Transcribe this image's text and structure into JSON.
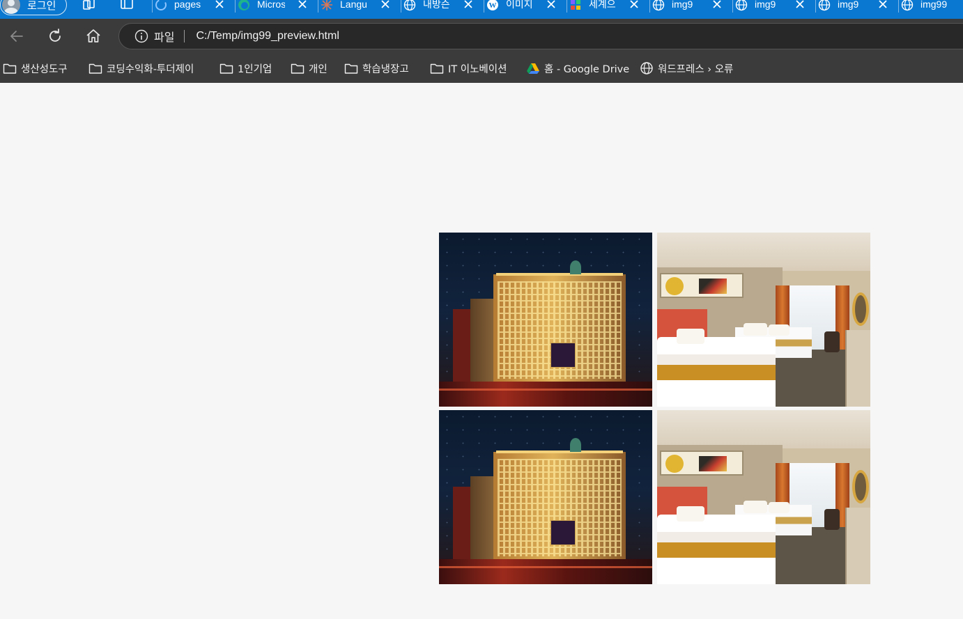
{
  "browser": {
    "profile": {
      "label": "로그인",
      "icon": "person-avatar-icon"
    },
    "tabs": [
      {
        "title": "pages",
        "favicon": "github-icon"
      },
      {
        "title": "Micros",
        "favicon": "edge-icon"
      },
      {
        "title": "Langu",
        "favicon": "claude-star-icon"
      },
      {
        "title": "내방슨",
        "favicon": "globe-icon"
      },
      {
        "title": "이미지",
        "favicon": "wordpress-icon"
      },
      {
        "title": "세계으",
        "favicon": "app-icon"
      },
      {
        "title": "img9",
        "favicon": "globe-icon"
      },
      {
        "title": "img9",
        "favicon": "globe-icon"
      },
      {
        "title": "img9",
        "favicon": "globe-icon"
      },
      {
        "title": "img99",
        "favicon": "globe-icon"
      }
    ],
    "address": {
      "scheme_label": "파일",
      "url": "C:/Temp/img99_preview.html"
    },
    "bookmarks": [
      {
        "label": "생산성도구",
        "icon": "folder-icon"
      },
      {
        "label": "코딩수익화-투더제이",
        "icon": "folder-icon"
      },
      {
        "label": "1인기업",
        "icon": "folder-icon"
      },
      {
        "label": "개인",
        "icon": "folder-icon"
      },
      {
        "label": "학습냉장고",
        "icon": "folder-icon"
      },
      {
        "label": "IT 이노베이션",
        "icon": "folder-icon"
      },
      {
        "label": "홈 - Google Drive",
        "icon": "google-drive-icon"
      },
      {
        "label": "워드프레스 › 오류",
        "icon": "globe-icon"
      }
    ]
  },
  "page": {
    "images": [
      {
        "subject": "hotel-exterior-night"
      },
      {
        "subject": "hotel-room"
      },
      {
        "subject": "hotel-exterior-night"
      },
      {
        "subject": "hotel-room"
      }
    ]
  },
  "colors": {
    "tabstrip": "#0a78d1",
    "toolbar": "#3b3b3b",
    "page_bg": "#f6f6f6"
  }
}
